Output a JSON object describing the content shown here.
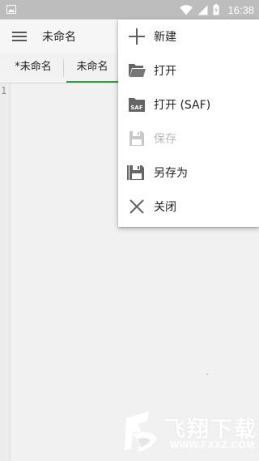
{
  "status_bar": {
    "time": "16:38",
    "left_icon": "gallery-icon",
    "right_icons": [
      "wifi-icon",
      "cellular-signal-icon",
      "battery-charging-icon"
    ],
    "bg_color": "#bdbdbd"
  },
  "app_bar": {
    "menu_icon": "hamburger-menu-icon",
    "title": "未命名"
  },
  "tabs": [
    {
      "label": "*未命名",
      "active": false
    },
    {
      "label": "未命名",
      "active": true
    }
  ],
  "accent_color": "#2e9a3f",
  "editor": {
    "line_numbers": [
      "1"
    ],
    "content": ""
  },
  "overflow_menu": {
    "items": [
      {
        "label": "新建",
        "icon": "plus-icon",
        "enabled": true
      },
      {
        "label": "打开",
        "icon": "folder-open-icon",
        "enabled": true
      },
      {
        "label": "打开 (SAF)",
        "icon": "saf-folder-icon",
        "enabled": true
      },
      {
        "label": "保存",
        "icon": "save-icon",
        "enabled": false
      },
      {
        "label": "另存为",
        "icon": "save-as-icon",
        "enabled": true
      },
      {
        "label": "关闭",
        "icon": "close-icon",
        "enabled": true
      }
    ]
  },
  "watermark": {
    "text": "飞翔下载",
    "url": "WWW.FXXZ.COM"
  }
}
